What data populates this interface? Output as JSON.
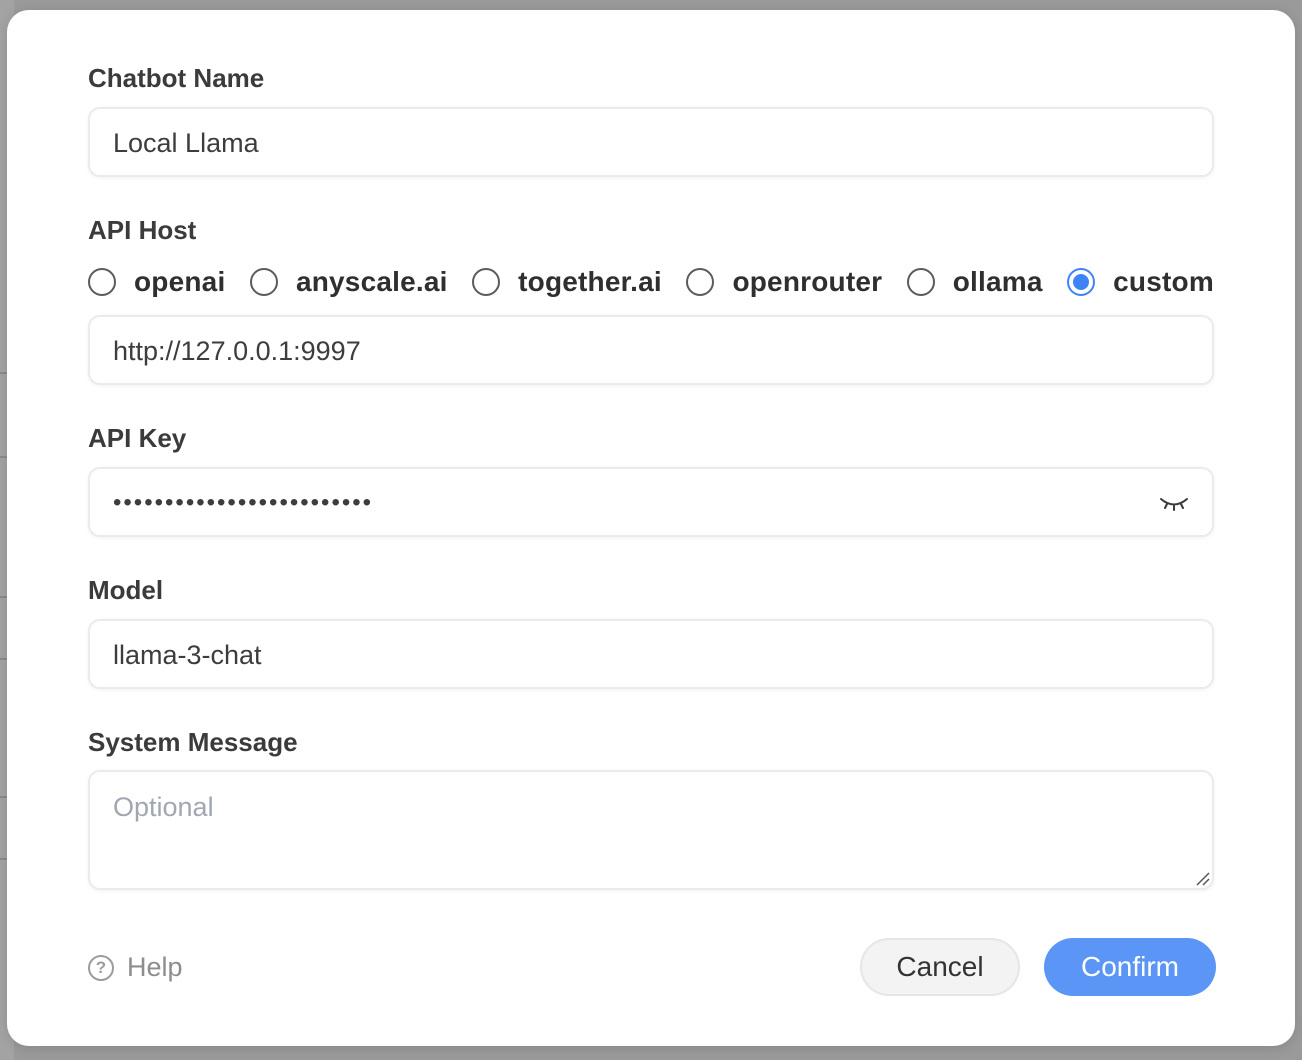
{
  "form": {
    "chatbot_name_label": "Chatbot Name",
    "chatbot_name_value": "Local Llama",
    "api_host_label": "API Host",
    "api_host_options": [
      "openai",
      "anyscale.ai",
      "together.ai",
      "openrouter",
      "ollama",
      "custom"
    ],
    "api_host_selected": "custom",
    "api_host_value": "http://127.0.0.1:9997",
    "api_key_label": "API Key",
    "api_key_value": "•••••••••••••••••••••••••",
    "model_label": "Model",
    "model_value": "llama-3-chat",
    "system_message_label": "System Message",
    "system_message_placeholder": "Optional"
  },
  "footer": {
    "help_label": "Help",
    "cancel_label": "Cancel",
    "confirm_label": "Confirm"
  },
  "icons": {
    "eye": "eye-closed-icon",
    "help": "question-circle-icon",
    "resize": "resize-handle-icon"
  },
  "colors": {
    "accent": "#3f84f6",
    "confirm_bg": "#5b96f7",
    "label": "#3b3b3b",
    "placeholder": "#a0a7b3"
  }
}
